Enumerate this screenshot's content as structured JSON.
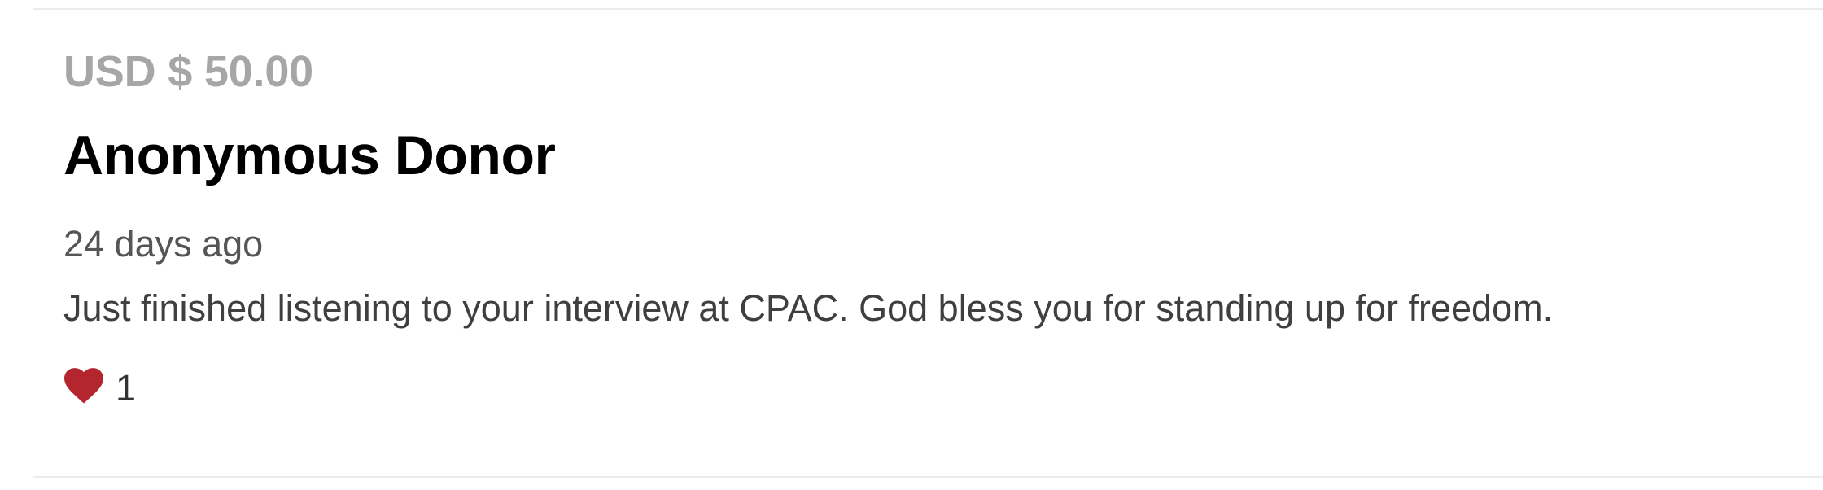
{
  "donation": {
    "amount": "USD $ 50.00",
    "donor_name": "Anonymous Donor",
    "timestamp": "24 days ago",
    "message": "Just finished listening to your interview at CPAC. God bless you for standing up for freedom.",
    "likes": {
      "icon": "heart-icon",
      "count": "1",
      "color": "#b3262e"
    }
  },
  "colors": {
    "amount_text": "#a6a6a6",
    "divider": "#ececec"
  }
}
